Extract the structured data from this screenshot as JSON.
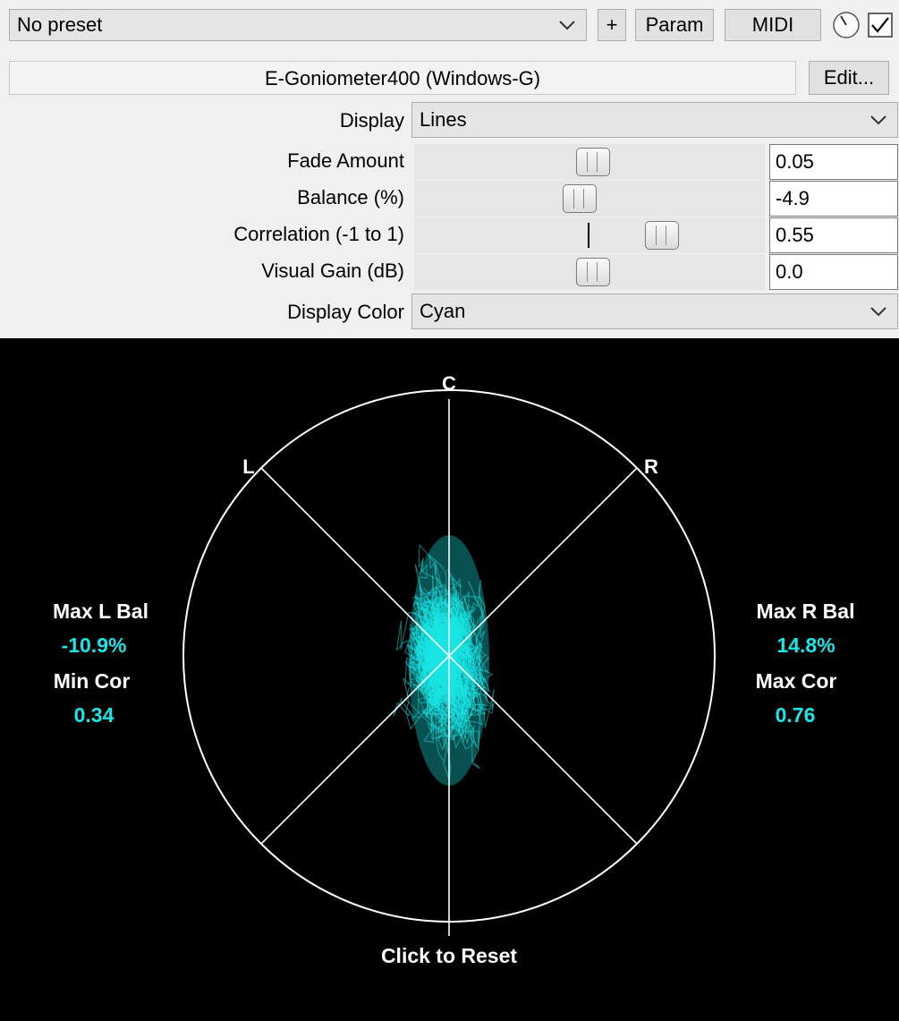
{
  "toolbar": {
    "preset": "No preset",
    "add_label": "+",
    "param_label": "Param",
    "midi_label": "MIDI",
    "enabled": true
  },
  "plugin": {
    "name": "E-Goniometer400 (Windows-G)",
    "edit_label": "Edit..."
  },
  "params": {
    "display": {
      "label": "Display",
      "value": "Lines"
    },
    "fade": {
      "label": "Fade Amount",
      "value": "0.05",
      "level": 0.51
    },
    "balance": {
      "label": "Balance (%)",
      "value": "-4.9",
      "level": 0.47
    },
    "correlation": {
      "label": "Correlation (-1 to 1)",
      "value": "0.55",
      "level": 0.73
    },
    "gain": {
      "label": "Visual Gain (dB)",
      "value": "0.0",
      "level": 0.51
    },
    "color": {
      "label": "Display Color",
      "value": "Cyan"
    }
  },
  "scope": {
    "label_c": "C",
    "label_l": "L",
    "label_r": "R",
    "max_l_bal_label": "Max L Bal",
    "max_l_bal_value": "-10.9%",
    "min_cor_label": "Min Cor",
    "min_cor_value": "0.34",
    "max_r_bal_label": "Max R Bal",
    "max_r_bal_value": "14.8%",
    "max_cor_label": "Max Cor",
    "max_cor_value": "0.76",
    "reset_label": "Click to Reset",
    "trace_color": "#19e6e6"
  }
}
